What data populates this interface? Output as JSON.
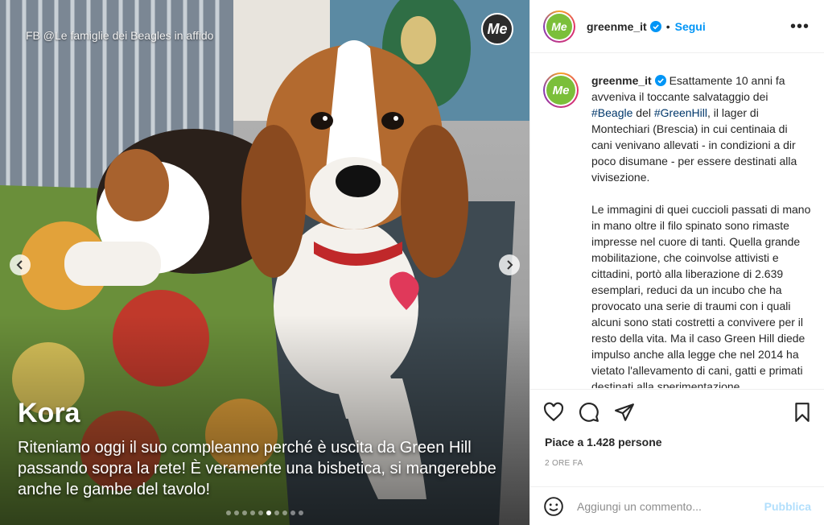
{
  "media": {
    "credit": "FB @Le famiglie dei Beagles in affido",
    "logo_text": "Me",
    "caption_name": "Kora",
    "caption_text": "Riteniamo oggi il suo compleanno perché è uscita da Green Hill passando sopra la rete! È veramente una bisbetica, si mangerebbe anche le gambe del tavolo!",
    "prev_icon": "chevron-left-icon",
    "next_icon": "chevron-right-icon",
    "carousel_total": 10,
    "carousel_active_index": 5
  },
  "header": {
    "username": "greenme_it",
    "avatar_text": "Me",
    "separator": "•",
    "follow_label": "Segui",
    "more_icon": "more-options-icon",
    "more_label": "•••"
  },
  "post": {
    "username": "greenme_it",
    "avatar_text": "Me",
    "text_1a": " Esattamente 10 anni fa avveniva il toccante salvataggio dei ",
    "hashtag_1": "#Beagle",
    "text_1b": " del ",
    "hashtag_2": "#GreenHill",
    "text_1c": ", il lager di Montechiari (Brescia) in cui centinaia di cani venivano allevati - in condizioni a dir poco disumane - per essere destinati alla vivisezione.",
    "paragraph_2": "Le immagini di quei cuccioli passati di mano in mano oltre il filo spinato sono rimaste impresse nel cuore di tanti. Quella grande mobilitazione, che coinvolse attivisti e cittadini, portò alla liberazione di 2.639 esemplari, reduci da un incubo che ha provocato una serie di traumi con i quali alcuni sono stati costretti a convivere per il resto della vita. Ma il caso Green Hill diede impulso anche alla legge che nel 2014 ha vietato l'allevamento di cani, gatti e primati destinati alla sperimentazione."
  },
  "actions": {
    "like_icon": "heart-icon",
    "comment_icon": "comment-icon",
    "share_icon": "send-icon",
    "save_icon": "bookmark-icon"
  },
  "likes_text": "Piace a 1.428 persone",
  "time_text": "2 ORE FA",
  "comment_box": {
    "emoji_icon": "emoji-icon",
    "placeholder": "Aggiungi un commento...",
    "publish_label": "Pubblica"
  },
  "colors": {
    "link_blue": "#0095f6",
    "hashtag": "#00376b",
    "publish_disabled": "#b2dffc",
    "brand_green": "#7bbf3a"
  }
}
